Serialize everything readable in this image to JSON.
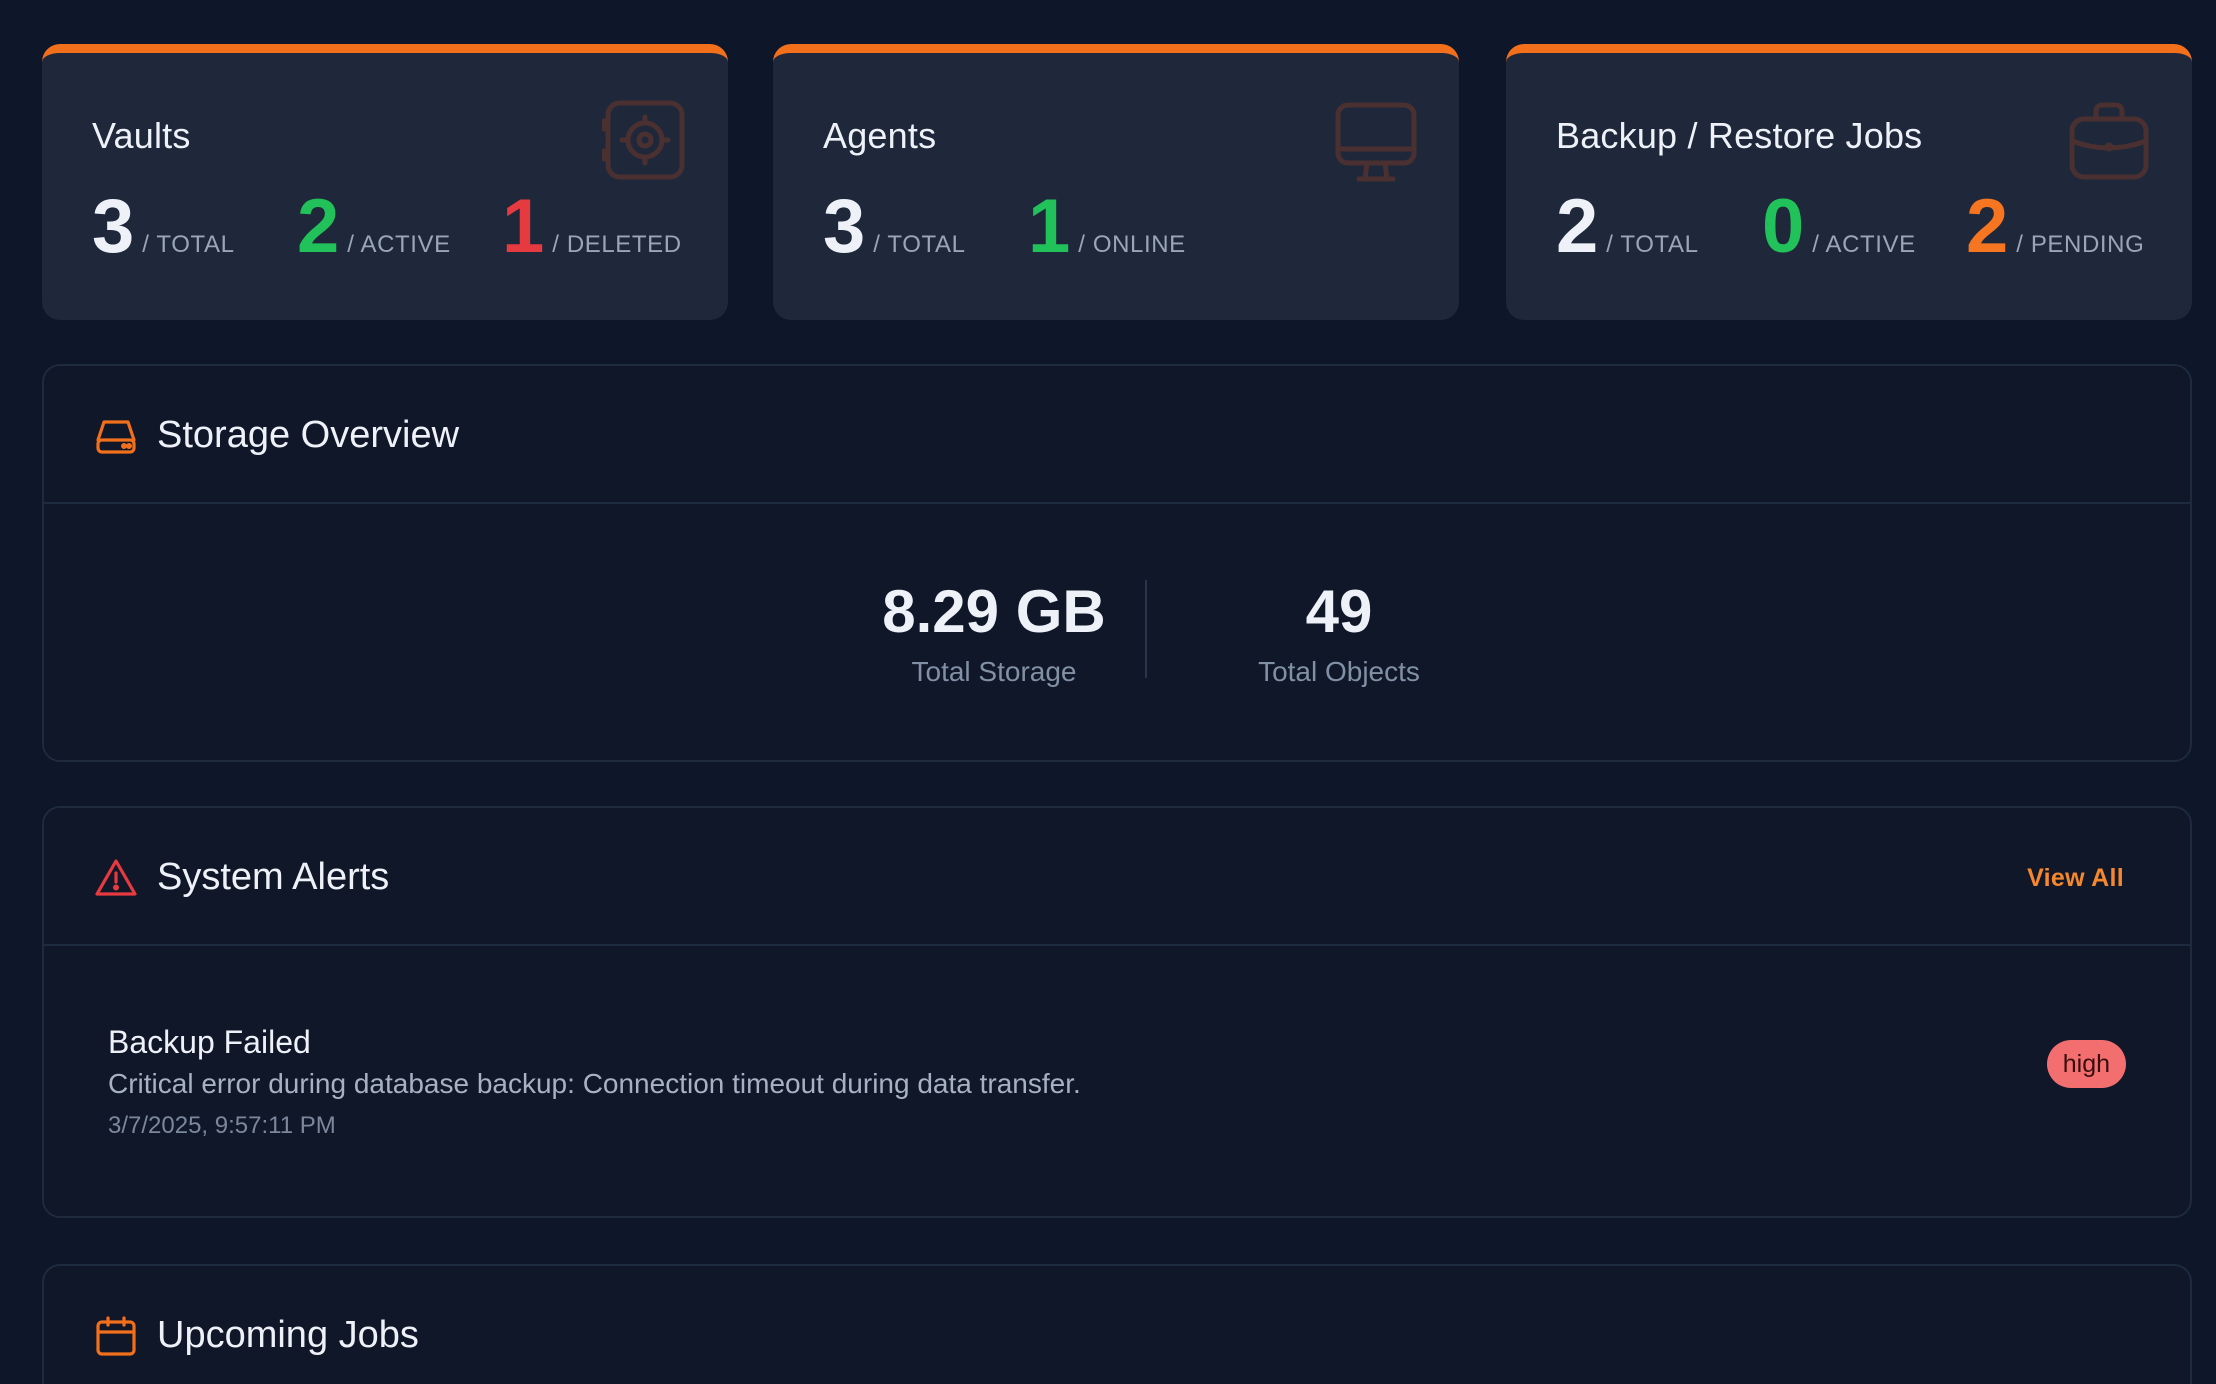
{
  "cards": {
    "vaults": {
      "title": "Vaults",
      "icon": "vault-icon",
      "stats": [
        {
          "value": "3",
          "label": "/ TOTAL",
          "color": "#eef2f8"
        },
        {
          "value": "2",
          "label": "/ ACTIVE",
          "color": "#22c25a"
        },
        {
          "value": "1",
          "label": "/ DELETED",
          "color": "#e53a40"
        }
      ]
    },
    "agents": {
      "title": "Agents",
      "icon": "monitor-icon",
      "stats": [
        {
          "value": "3",
          "label": "/ TOTAL",
          "color": "#eef2f8"
        },
        {
          "value": "1",
          "label": "/ ONLINE",
          "color": "#22c25a"
        }
      ]
    },
    "jobs": {
      "title": "Backup / Restore Jobs",
      "icon": "briefcase-icon",
      "stats": [
        {
          "value": "2",
          "label": "/ TOTAL",
          "color": "#eef2f8"
        },
        {
          "value": "0",
          "label": "/ ACTIVE",
          "color": "#22c25a"
        },
        {
          "value": "2",
          "label": "/ PENDING",
          "color": "#f57521"
        }
      ]
    }
  },
  "storage": {
    "title": "Storage Overview",
    "icon": "hard-drive-icon",
    "total_storage": {
      "value": "8.29 GB",
      "label": "Total Storage"
    },
    "total_objects": {
      "value": "49",
      "label": "Total Objects"
    }
  },
  "alerts": {
    "title": "System Alerts",
    "icon": "warning-triangle-icon",
    "view_all_label": "View All",
    "items": [
      {
        "title": "Backup Failed",
        "description": "Critical error during database backup: Connection timeout during data transfer.",
        "timestamp": "3/7/2025, 9:57:11 PM",
        "severity": "high"
      }
    ]
  },
  "upcoming": {
    "title": "Upcoming Jobs",
    "icon": "calendar-icon"
  },
  "colors": {
    "accent": "#f26f1c",
    "success": "#22c25a",
    "danger": "#e53a40",
    "warning": "#f57521",
    "background": "#0e1629",
    "card": "#1e283a"
  }
}
